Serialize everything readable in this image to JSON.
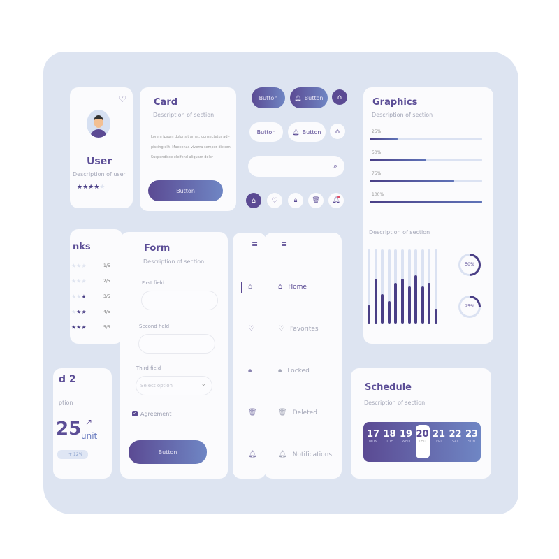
{
  "colors": {
    "accent": "#5b4a93",
    "accent_light": "#6f86c4",
    "background": "#dde4f1",
    "card": "#fbfbfd"
  },
  "user": {
    "name": "User",
    "description": "Description of user",
    "rating": 4,
    "max": 5,
    "icons": [
      "heart-icon",
      "avatar"
    ]
  },
  "card": {
    "title": "Card",
    "description": "Description of section",
    "body": [
      "Lorem ipsum dolor sit amet, consectetur adi-",
      "piscing elit. Maecenas viverra semper dictum.",
      "Suspendisse eleifend aliquam dolor"
    ],
    "button": "Button"
  },
  "buttons": {
    "filled": "Button",
    "filled_bell": "Button",
    "outline": "Button",
    "outline_bell": "Button"
  },
  "search": {
    "placeholder": "",
    "icon": "search-icon"
  },
  "icons_row": [
    "home-icon",
    "heart-icon",
    "lock-icon",
    "trash-icon",
    "bell-icon"
  ],
  "graphics": {
    "title": "Graphics",
    "description": "Description of section",
    "progress": [
      {
        "label": "25%",
        "value": 25
      },
      {
        "label": "50%",
        "value": 50
      },
      {
        "label": "75%",
        "value": 75
      },
      {
        "label": "100%",
        "value": 100
      }
    ],
    "chart_description": "Description of section",
    "bars": [
      25,
      60,
      40,
      30,
      55,
      60,
      50,
      65,
      50,
      55,
      20
    ],
    "rings": [
      {
        "label": "50%",
        "value": 50
      },
      {
        "label": "25%",
        "value": 25
      }
    ]
  },
  "ranks": {
    "title": "nks",
    "items": [
      {
        "label": "1/5",
        "stars": 1
      },
      {
        "label": "2/5",
        "stars": 2
      },
      {
        "label": "3/5",
        "stars": 3
      },
      {
        "label": "4/5",
        "stars": 4
      },
      {
        "label": "5/5",
        "stars": 5
      }
    ]
  },
  "form": {
    "title": "Form",
    "description": "Description of section",
    "first_label": "First field",
    "second_label": "Second field",
    "third_label": "Third field",
    "select_placeholder": "Select option",
    "agreement": "Agreement",
    "button": "Button"
  },
  "nav": {
    "items": [
      {
        "label": "Home",
        "icon": "home-icon"
      },
      {
        "label": "Favorites",
        "icon": "heart-icon"
      },
      {
        "label": "Locked",
        "icon": "lock-icon"
      },
      {
        "label": "Deleted",
        "icon": "trash-icon"
      },
      {
        "label": "Notifications",
        "icon": "bell-icon"
      }
    ]
  },
  "card2": {
    "title": "d 2",
    "description": "ption",
    "value": "25",
    "unit": "unit",
    "change": "+ 12%"
  },
  "schedule": {
    "title": "Schedule",
    "description": "Description of section",
    "days": [
      {
        "num": "17",
        "name": "MON"
      },
      {
        "num": "18",
        "name": "TUE"
      },
      {
        "num": "19",
        "name": "WED"
      },
      {
        "num": "20",
        "name": "THU"
      },
      {
        "num": "21",
        "name": "FRI"
      },
      {
        "num": "22",
        "name": "SAT"
      },
      {
        "num": "23",
        "name": "SUN"
      }
    ],
    "selected": "20"
  }
}
